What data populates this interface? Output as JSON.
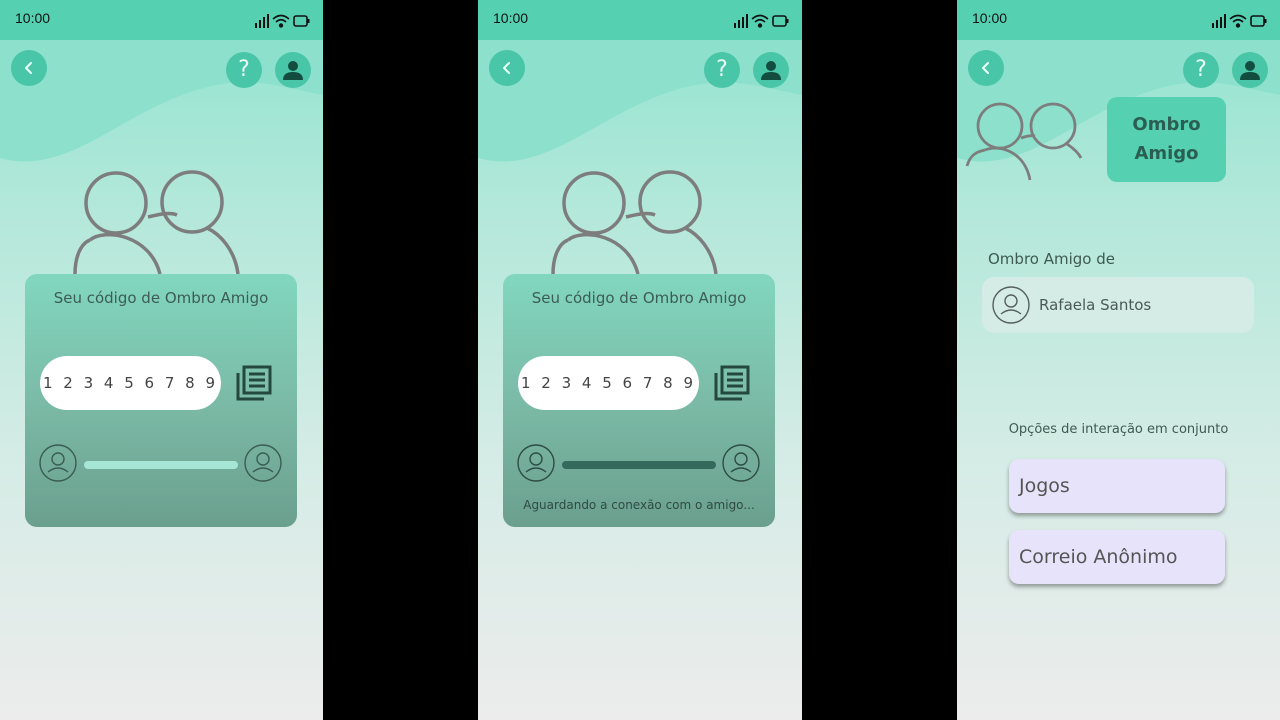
{
  "status_bar": {
    "time": "10:00"
  },
  "colors": {
    "status_bar": "#55d1b2",
    "accent": "#49c6a7",
    "card_top": "#82d7bf",
    "card_bottom": "#6b9f8e",
    "option_button": "#e6e3fb"
  },
  "icons": {
    "back": "chevron-left-icon",
    "help": "question-mark-icon",
    "profile": "user-icon",
    "copy": "copy-documents-icon",
    "friends": "two-people-outline-icon",
    "avatar": "person-outline-icon"
  },
  "screen1": {
    "help_glyph": "?",
    "card_title": "Seu código de Ombro Amigo",
    "code": "1 2 3 4 5 6 7 8 9"
  },
  "screen2": {
    "help_glyph": "?",
    "card_title": "Seu código de Ombro Amigo",
    "code": "1 2 3 4 5 6 7 8 9",
    "waiting_text": "Aguardando a conexão com o amigo..."
  },
  "screen3": {
    "help_glyph": "?",
    "title_line1": "Ombro",
    "title_line2": "Amigo",
    "section_label": "Ombro Amigo de",
    "friend_name": "Rafaela Santos",
    "options_label": "Opções de interação em conjunto",
    "options": [
      {
        "label": "Jogos"
      },
      {
        "label": "Correio Anônimo"
      }
    ]
  }
}
